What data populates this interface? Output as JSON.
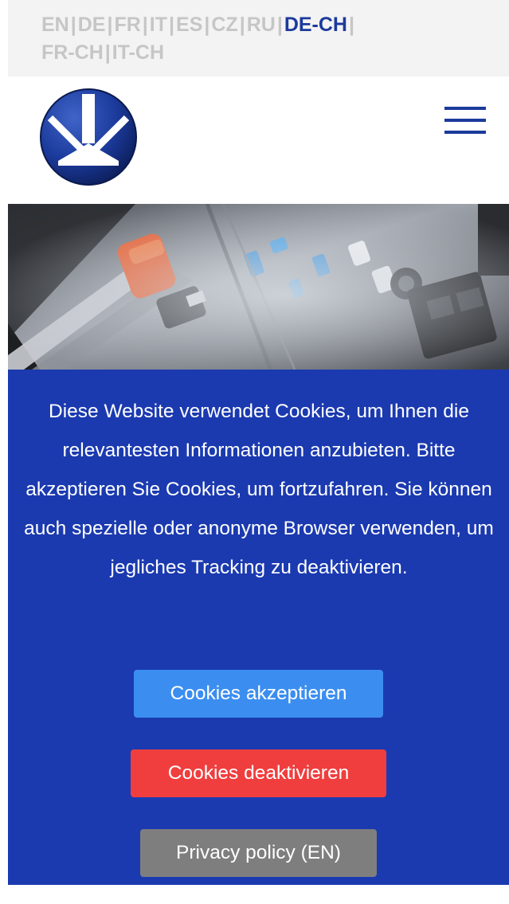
{
  "language_bar": {
    "line1": [
      {
        "code": "EN",
        "active": false
      },
      {
        "code": "DE",
        "active": false
      },
      {
        "code": "FR",
        "active": false
      },
      {
        "code": "IT",
        "active": false
      },
      {
        "code": "ES",
        "active": false
      },
      {
        "code": "CZ",
        "active": false
      },
      {
        "code": "RU",
        "active": false
      },
      {
        "code": "DE-CH",
        "active": true
      }
    ],
    "line2": [
      {
        "code": "FR-CH",
        "active": false
      },
      {
        "code": "IT-CH",
        "active": false
      }
    ],
    "separator": "|",
    "colors": {
      "inactive": "#c6c6c6",
      "active": "#1b3a9b",
      "background": "#f3f3f3"
    }
  },
  "header": {
    "logo_icon": "company-logo-emblem",
    "menu_icon": "hamburger-menu-icon",
    "accent_color": "#1b3a9b"
  },
  "hero": {
    "image_icon": "machine-components-photo"
  },
  "cookie_banner": {
    "message": "Diese Website verwendet Cookies, um Ihnen die relevantesten Informationen anzubieten. Bitte akzeptieren Sie Cookies, um fortzufahren. Sie können auch spezielle oder anonyme Browser verwenden, um jegliches Tracking zu deaktivieren.",
    "accept_label": "Cookies akzeptieren",
    "decline_label": "Cookies deaktivieren",
    "privacy_label": "Privacy policy (EN)",
    "colors": {
      "background": "#1b3ab0",
      "accept": "#3b8ef0",
      "decline": "#f03e3e",
      "privacy": "#7e7e7e"
    }
  }
}
